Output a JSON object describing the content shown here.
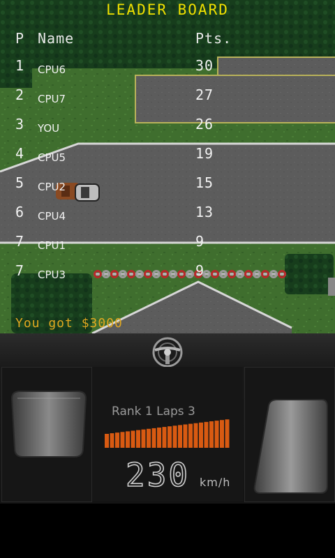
{
  "leaderboard": {
    "title": "LEADER BOARD",
    "headers": {
      "pos": "P",
      "name": "Name",
      "pts": "Pts."
    },
    "rows": [
      {
        "pos": "1",
        "name": "CPU6",
        "pts": "30"
      },
      {
        "pos": "2",
        "name": "CPU7",
        "pts": "27"
      },
      {
        "pos": "3",
        "name": "YOU",
        "pts": "26"
      },
      {
        "pos": "4",
        "name": "CPU5",
        "pts": "19"
      },
      {
        "pos": "5",
        "name": "CPU2",
        "pts": "15"
      },
      {
        "pos": "6",
        "name": "CPU4",
        "pts": "13"
      },
      {
        "pos": "7",
        "name": "CPU1",
        "pts": "9"
      },
      {
        "pos": "7",
        "name": "CPU3",
        "pts": "9"
      }
    ],
    "prize": "You got $3000"
  },
  "hud": {
    "rank_laps": "Rank 1  Laps 3",
    "speed": "230",
    "unit": "km/h",
    "rpm_level": 1.0
  },
  "colors": {
    "title": "#f0e000",
    "prize": "#e0a820",
    "grass": "#3f6e2e",
    "asphalt": "#5c5c5c",
    "rpm": "#d85a12"
  },
  "icons": {
    "wheel": "steering-wheel-icon",
    "brake": "brake-pedal-icon",
    "accelerator": "accelerator-pedal-icon"
  }
}
